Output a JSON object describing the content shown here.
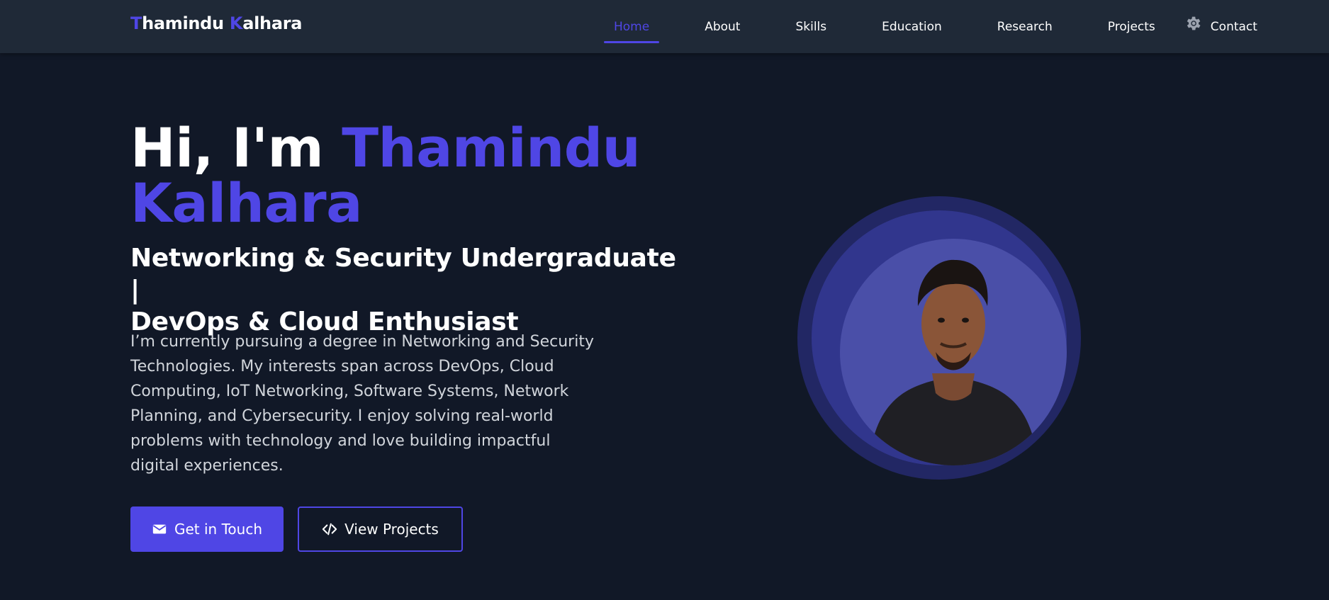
{
  "logo": {
    "initial_first": "T",
    "rest_first": "hamindu ",
    "initial_last": "K",
    "rest_last": "alhara"
  },
  "nav": {
    "items": [
      {
        "label": "Home",
        "active": true
      },
      {
        "label": "About"
      },
      {
        "label": "Skills"
      },
      {
        "label": "Education"
      },
      {
        "label": "Research"
      },
      {
        "label": "Projects"
      },
      {
        "label": "Contact"
      }
    ],
    "theme_toggle_icon": "gear-icon"
  },
  "hero": {
    "greeting": "Hi, I'm ",
    "name_first": "Thamindu",
    "name_last": "Kalhara",
    "subtitle_line1": "Networking & Security Undergraduate |",
    "subtitle_line2": "DevOps & Cloud Enthusiast",
    "description": "I’m currently pursuing a degree in Networking and Security Technologies. My interests span across DevOps, Cloud Computing, IoT Networking, Software Systems, Network Planning, and Cybersecurity. I enjoy solving real-world problems with technology and love building impactful digital experiences.",
    "primary_button": {
      "label": "Get in Touch",
      "icon": "envelope-icon"
    },
    "secondary_button": {
      "label": "View Projects",
      "icon": "code-icon"
    }
  },
  "colors": {
    "accent": "#4f46e5",
    "background": "#111827",
    "navbar": "#1f2937"
  }
}
